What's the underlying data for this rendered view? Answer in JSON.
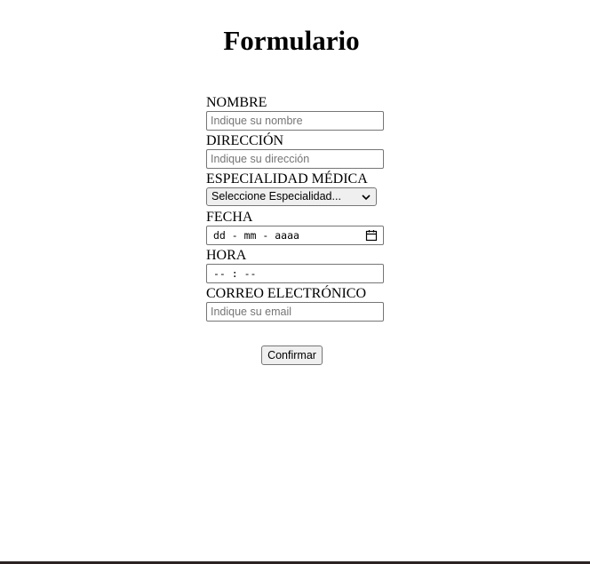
{
  "page": {
    "title": "Formulario"
  },
  "form": {
    "nombre": {
      "label": "NOMBRE",
      "placeholder": "Indique su nombre"
    },
    "direccion": {
      "label": "DIRECCIÓN",
      "placeholder": "Indique su dirección"
    },
    "especialidad": {
      "label": "ESPECIALIDAD MÉDICA",
      "selected": "Seleccione Especialidad..."
    },
    "fecha": {
      "label": "FECHA",
      "value": "dd - mm - aaaa"
    },
    "hora": {
      "label": "HORA",
      "value": "-- : --"
    },
    "correo": {
      "label": "CORREO ELECTRÓNICO",
      "placeholder": "Indique su email"
    },
    "submit_label": "Confirmar"
  },
  "icons": {
    "select_arrow": "chevron-down-icon",
    "date_picker": "calendar-icon"
  }
}
